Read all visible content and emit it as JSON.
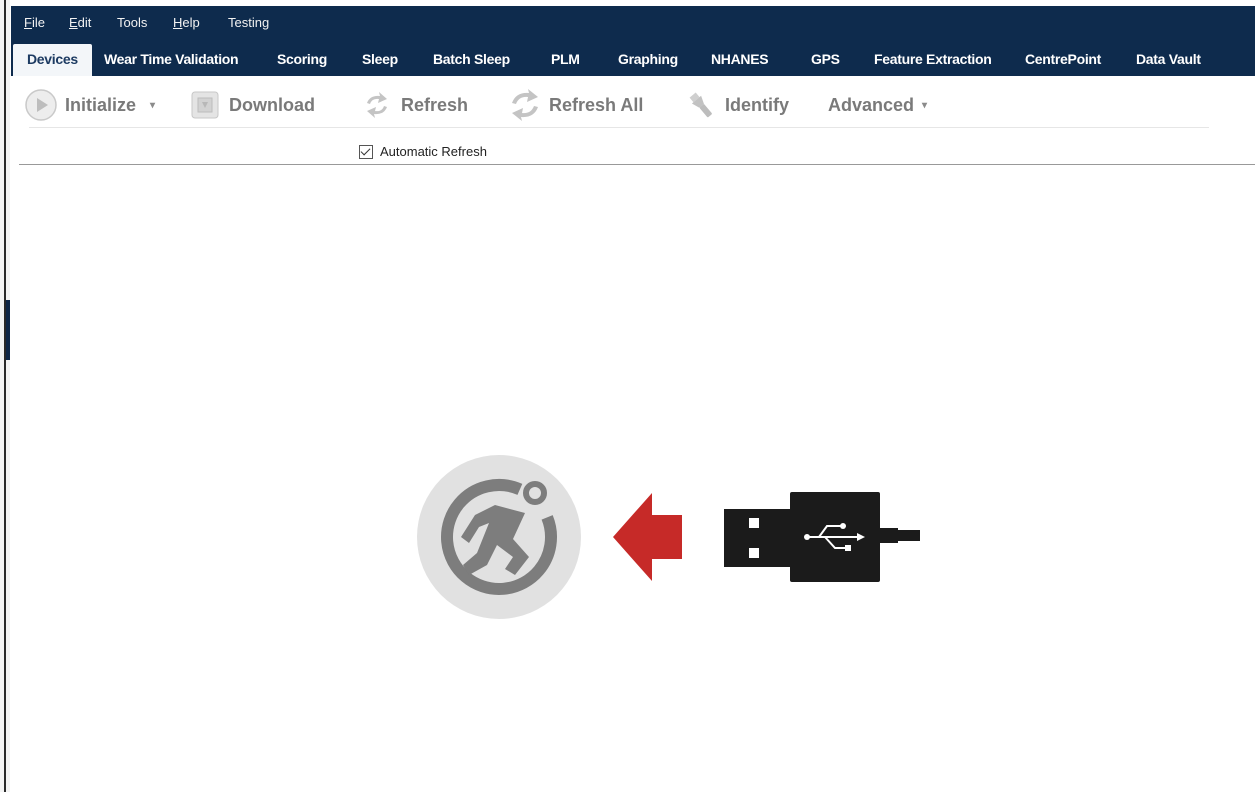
{
  "menubar": {
    "items": [
      {
        "label": "File"
      },
      {
        "label": "Edit"
      },
      {
        "label": "Tools"
      },
      {
        "label": "Help"
      },
      {
        "label": "Testing"
      }
    ]
  },
  "tabs": [
    {
      "label": "Devices",
      "active": true
    },
    {
      "label": "Wear Time Validation"
    },
    {
      "label": "Scoring"
    },
    {
      "label": "Sleep"
    },
    {
      "label": "Batch Sleep"
    },
    {
      "label": "PLM"
    },
    {
      "label": "Graphing"
    },
    {
      "label": "NHANES"
    },
    {
      "label": "GPS"
    },
    {
      "label": "Feature Extraction"
    },
    {
      "label": "CentrePoint"
    },
    {
      "label": "Data Vault"
    }
  ],
  "toolbar": {
    "initialize": "Initialize",
    "download": "Download",
    "refresh": "Refresh",
    "refresh_all": "Refresh All",
    "identify": "Identify",
    "advanced": "Advanced",
    "auto_refresh": "Automatic Refresh",
    "auto_refresh_checked": true
  },
  "colors": {
    "menubar_bg": "#0e2b4d",
    "arrow_red": "#c62a28",
    "usb_black": "#1b1b1b",
    "device_circle": "#e1e1e1",
    "disabled_text": "#7a7a7a"
  },
  "icons": [
    "play-icon",
    "download-icon",
    "refresh-icon",
    "refresh-all-icon",
    "flashlight-icon",
    "device-logo-icon",
    "arrow-left-icon",
    "usb-plug-icon",
    "usb-symbol-icon"
  ]
}
